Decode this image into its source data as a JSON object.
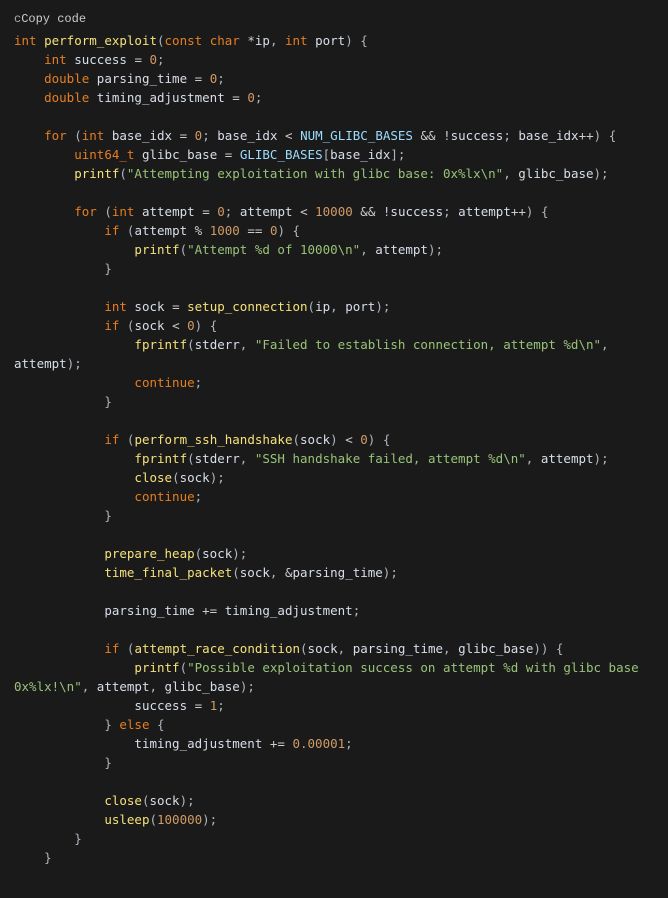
{
  "copy_label": "Copy code",
  "code": {
    "sig_int": "int",
    "sig_fn": "perform_exploit",
    "sig_const": "const",
    "sig_char": "char",
    "sig_ip": "ip",
    "sig_int2": "int",
    "sig_port": "port",
    "decl_int1": "int",
    "decl_success": "success",
    "zero": "0",
    "decl_double1": "double",
    "decl_parsing": "parsing_time",
    "decl_double2": "double",
    "decl_timing": "timing_adjustment",
    "for_kw": "for",
    "int_kw": "int",
    "base_idx": "base_idx",
    "num_glibc": "NUM_GLIBC_BASES",
    "success_v": "success",
    "uint64": "uint64_t",
    "glibc_base": "glibc_base",
    "glibc_bases": "GLIBC_BASES",
    "printf": "printf",
    "str_attempting": "\"Attempting exploitation with glibc base: 0x%lx\\n\"",
    "attempt": "attempt",
    "ten_k": "10000",
    "thousand": "1000",
    "if_kw": "if",
    "str_attempt_n": "\"Attempt %d of 10000\\n\"",
    "sock": "sock",
    "setup_conn": "setup_connection",
    "fprintf": "fprintf",
    "stderr": "stderr",
    "str_failed_conn": "\"Failed to establish connection, attempt %d\\n\"",
    "continue_kw": "continue",
    "perform_ssh": "perform_ssh_handshake",
    "str_ssh_fail": "\"SSH handshake failed, attempt %d\\n\"",
    "close_fn": "close",
    "prepare_heap": "prepare_heap",
    "time_final": "time_final_packet",
    "attempt_race": "attempt_race_condition",
    "str_possible": "\"Possible exploitation success on attempt %d with glibc base 0x%lx!\\n\"",
    "one": "1",
    "else_kw": "else",
    "delta": "0.00001",
    "usleep": "usleep",
    "usleep_val": "100000"
  }
}
